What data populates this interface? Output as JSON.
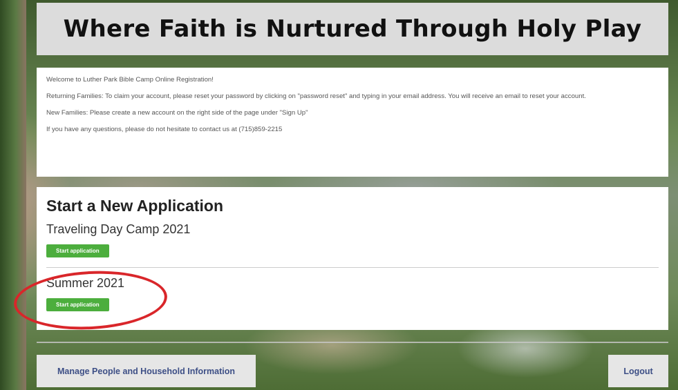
{
  "header": {
    "title": "Where Faith is Nurtured Through Holy Play"
  },
  "welcome": {
    "line1": "Welcome to Luther Park Bible Camp Online Registration!",
    "line2": "Returning Families: To claim your account, please reset your password by clicking on \"password reset\" and typing in your email address. You will receive an email to reset your account.",
    "line3": "New Families: Please create a new account on the right side of the page under \"Sign Up\"",
    "line4": "If you have any questions, please do not hesitate to contact us at (715)859-2215"
  },
  "applications": {
    "heading": "Start a New Application",
    "items": [
      {
        "name": "Traveling Day Camp 2021",
        "button_label": "Start application"
      },
      {
        "name": "Summer 2021",
        "button_label": "Start application"
      }
    ]
  },
  "footer": {
    "manage_label": "Manage People and Household Information",
    "logout_label": "Logout"
  },
  "colors": {
    "button_green": "#4cae3d",
    "link_blue": "#3d4f86",
    "highlight_red": "#d9262a"
  }
}
